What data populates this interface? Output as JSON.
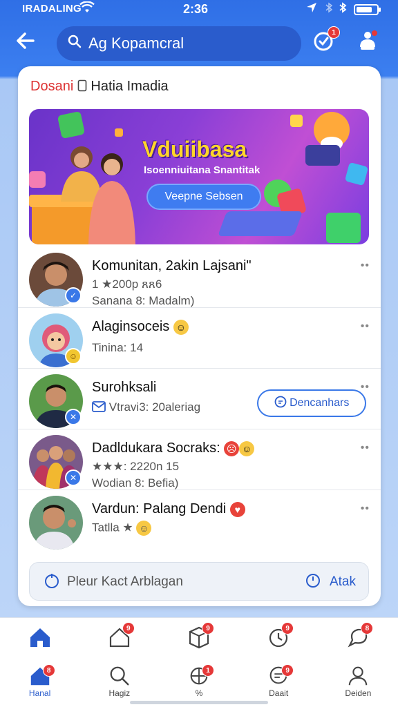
{
  "status": {
    "carrier": "IRADALING",
    "time": "2:36"
  },
  "topbar": {
    "search_text": "Ag Kopamcral",
    "notif_badge": "1"
  },
  "card": {
    "title_red": "Dosani",
    "title_dark": "Hatia Imadia"
  },
  "banner": {
    "headline": "Vduiibasa",
    "subtitle": "Isoenniuitana Snantitak",
    "cta": "Veepne Sebsen"
  },
  "items": [
    {
      "name": "Komunitan, 2akin Lajsani\"",
      "meta": "1 ★200p ጸጸ6",
      "meta2": "Sanana 8: Madalm)"
    },
    {
      "name": "Alaginsoceis",
      "meta": "Tinina: 14"
    },
    {
      "name": "Surohksali",
      "meta": "Vtravi3: 20aleriag",
      "button": "Dencanhars"
    },
    {
      "name": "Dadldukara Socraks:",
      "meta": "★★★: 2220n 15",
      "meta2": "Wodian 8: Befia)"
    },
    {
      "name": "Vardun: Palang Dendi",
      "meta": "Tatlla ★"
    }
  ],
  "composer": {
    "placeholder": "Pleur Kact Arblagan",
    "action": "Atak"
  },
  "nav_top_badges": [
    "9",
    "9",
    "9",
    "8"
  ],
  "nav_bottom": [
    {
      "label": "Hanal",
      "badge": "8"
    },
    {
      "label": "Hagiz",
      "badge": ""
    },
    {
      "label": "%",
      "badge": "1"
    },
    {
      "label": "Daait",
      "badge": "9"
    },
    {
      "label": "Deiden",
      "badge": ""
    }
  ],
  "colors": {
    "primary": "#2f6fe6",
    "badge_red": "#e53838",
    "banner_purple": "#8a3fd6",
    "headline_yellow": "#ffd52a"
  }
}
